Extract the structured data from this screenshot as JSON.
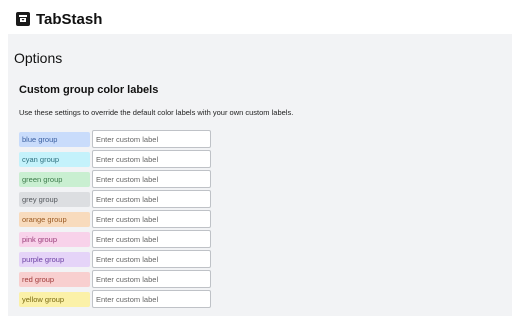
{
  "app": {
    "title": "TabStash",
    "icon": "tabstash-logo-icon"
  },
  "page": {
    "title": "Options"
  },
  "section": {
    "title": "Custom group color labels",
    "description": "Use these settings to override the default color labels with your own custom labels."
  },
  "groups": [
    {
      "label": "blue group",
      "bg": "#c9dcfb",
      "fg": "#3b5fa0",
      "value": "",
      "placeholder": "Enter custom label"
    },
    {
      "label": "cyan group",
      "bg": "#c4f2fb",
      "fg": "#2d6f7d",
      "value": "",
      "placeholder": "Enter custom label"
    },
    {
      "label": "green group",
      "bg": "#c9efd1",
      "fg": "#3c7a4a",
      "value": "",
      "placeholder": "Enter custom label"
    },
    {
      "label": "grey group",
      "bg": "#dcdee1",
      "fg": "#55595e",
      "value": "",
      "placeholder": "Enter custom label"
    },
    {
      "label": "orange group",
      "bg": "#f8dbbd",
      "fg": "#9a5a23",
      "value": "",
      "placeholder": "Enter custom label"
    },
    {
      "label": "pink group",
      "bg": "#f8d2ea",
      "fg": "#9a3d7a",
      "value": "",
      "placeholder": "Enter custom label"
    },
    {
      "label": "purple group",
      "bg": "#e5d4f8",
      "fg": "#6b3fa3",
      "value": "",
      "placeholder": "Enter custom label"
    },
    {
      "label": "red group",
      "bg": "#f8cfcf",
      "fg": "#a03a3a",
      "value": "",
      "placeholder": "Enter custom label"
    },
    {
      "label": "yellow group",
      "bg": "#fbf1a8",
      "fg": "#7a6a12",
      "value": "",
      "placeholder": "Enter custom label"
    }
  ]
}
